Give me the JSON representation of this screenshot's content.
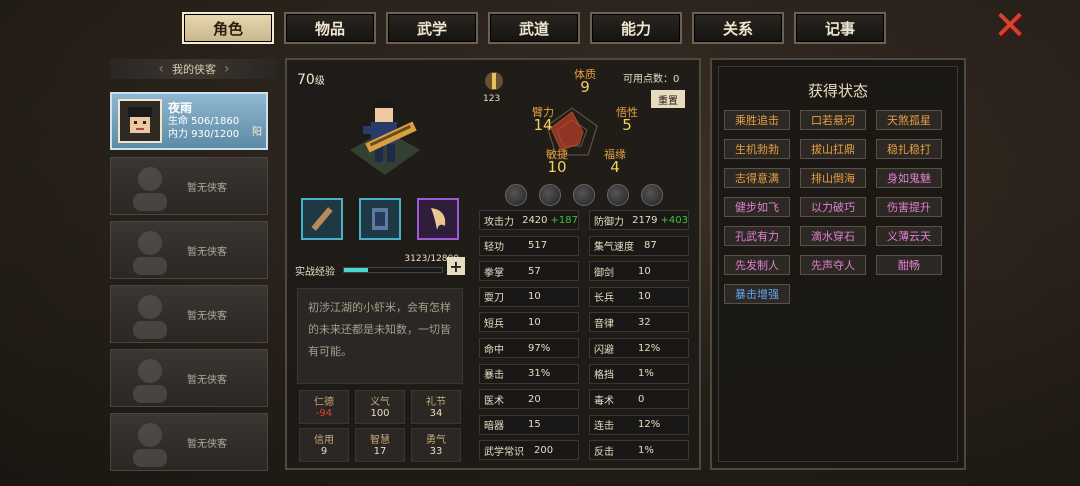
{
  "tabs": [
    "角色",
    "物品",
    "武学",
    "武道",
    "能力",
    "关系",
    "记事"
  ],
  "active_tab": 0,
  "close_icon": "close-x-icon",
  "roster": {
    "header": "我的侠客",
    "hero": {
      "name": "夜雨",
      "hp": "生命 506/1860",
      "mp": "内力 930/1200",
      "alignment": "阳"
    },
    "empty_label": "暂无侠客"
  },
  "character": {
    "level": "70",
    "level_unit": "级",
    "xp_label": "实战经验",
    "xp_text": "3123/12800",
    "xp_fraction": 0.244,
    "description": "初涉江湖的小虾米，会有怎样的未来还都是未知数，一切皆有可能。",
    "virtues": [
      {
        "label": "仁德",
        "value": "-94",
        "neg": true
      },
      {
        "label": "义气",
        "value": "100"
      },
      {
        "label": "礼节",
        "value": "34"
      },
      {
        "label": "信用",
        "value": "9"
      },
      {
        "label": "智慧",
        "value": "17"
      },
      {
        "label": "勇气",
        "value": "33"
      }
    ]
  },
  "attributes": {
    "points_label": "可用点数：",
    "points": "0",
    "reset": "重置",
    "power_num": "123",
    "radar": [
      {
        "label": "体质",
        "value": "9"
      },
      {
        "label": "悟性",
        "value": "5"
      },
      {
        "label": "福缘",
        "value": "4"
      },
      {
        "label": "敏捷",
        "value": "10"
      },
      {
        "label": "臂力",
        "value": "14"
      }
    ]
  },
  "stats_left": [
    {
      "k": "攻击力",
      "v": "2420",
      "plus": "+187"
    },
    {
      "k": "轻功",
      "v": "517"
    },
    {
      "k": "拳掌",
      "v": "57"
    },
    {
      "k": "耍刀",
      "v": "10"
    },
    {
      "k": "短兵",
      "v": "10"
    },
    {
      "k": "命中",
      "v": "97%"
    },
    {
      "k": "暴击",
      "v": "31%"
    },
    {
      "k": "医术",
      "v": "20"
    },
    {
      "k": "暗器",
      "v": "15"
    },
    {
      "k": "武学常识",
      "v": "200"
    }
  ],
  "stats_right": [
    {
      "k": "防御力",
      "v": "2179",
      "plus": "+403"
    },
    {
      "k": "集气速度",
      "v": "87"
    },
    {
      "k": "御剑",
      "v": "10"
    },
    {
      "k": "长兵",
      "v": "10"
    },
    {
      "k": "音律",
      "v": "32"
    },
    {
      "k": "闪避",
      "v": "12%"
    },
    {
      "k": "格挡",
      "v": "1%"
    },
    {
      "k": "毒术",
      "v": "0"
    },
    {
      "k": "连击",
      "v": "12%"
    },
    {
      "k": "反击",
      "v": "1%"
    }
  ],
  "status": {
    "title": "获得状态",
    "buffs": [
      {
        "t": "乘胜追击",
        "c": "orange"
      },
      {
        "t": "口若悬河",
        "c": "orange"
      },
      {
        "t": "天煞孤星",
        "c": "orange"
      },
      {
        "t": "生机勃勃",
        "c": "orange"
      },
      {
        "t": "拔山扛鼎",
        "c": "orange"
      },
      {
        "t": "稳扎稳打",
        "c": "orange"
      },
      {
        "t": "志得意满",
        "c": "orange"
      },
      {
        "t": "排山倒海",
        "c": "orange"
      },
      {
        "t": "身如鬼魅",
        "c": "pink"
      },
      {
        "t": "健步如飞",
        "c": "pink"
      },
      {
        "t": "以力破巧",
        "c": "pink"
      },
      {
        "t": "伤害提升",
        "c": "pink"
      },
      {
        "t": "孔武有力",
        "c": "pink"
      },
      {
        "t": "滴水穿石",
        "c": "pink"
      },
      {
        "t": "义薄云天",
        "c": "pink"
      },
      {
        "t": "先发制人",
        "c": "pink"
      },
      {
        "t": "先声夺人",
        "c": "pink"
      },
      {
        "t": "酣畅",
        "c": "pink"
      },
      {
        "t": "暴击增强",
        "c": "blue"
      }
    ]
  }
}
